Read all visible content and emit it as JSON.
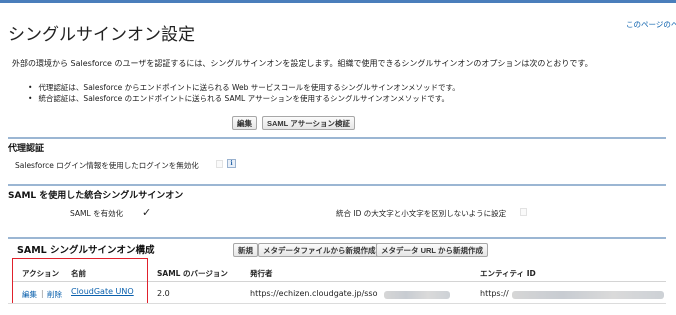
{
  "page": {
    "title": "シングルサインオン設定",
    "help_link": "このページのヘルプ"
  },
  "intro": {
    "text": "外部の環境から Salesforce のユーザを認証するには、シングルサインオンを設定します。組織で使用できるシングルサインオンのオプションは次のとおりです。",
    "bullets": [
      "代理認証は、Salesforce からエンドポイントに送られる Web サービスコールを使用するシングルサインオンメソッドです。",
      "統合認証は、Salesforce のエンドポイントに送られる SAML アサーションを使用するシングルサインオンメソッドです。"
    ]
  },
  "toolbar": {
    "edit_label": "編集",
    "saml_validate_label": "SAML アサーション検証"
  },
  "delegated": {
    "heading": "代理認証",
    "disable_login_label": "Salesforce ログイン情報を使用したログインを無効化",
    "info_icon": "i"
  },
  "saml_federated": {
    "heading": "SAML を使用した統合シングルサインオン",
    "enabled_label": "SAML を有効化",
    "enabled_mark": "✓",
    "case_insensitive_label": "統合 ID の大文字と小文字を区別しないように設定"
  },
  "saml_config": {
    "heading": "SAML シングルサインオン構成",
    "new_label": "新規",
    "new_from_metadata_file_label": "メタデータファイルから新規作成",
    "new_from_metadata_url_label": "メタデータ URL から新規作成",
    "columns": {
      "action": "アクション",
      "name": "名前",
      "saml_version": "SAML のバージョン",
      "issuer": "発行者",
      "entity_id": "エンティティ ID"
    },
    "rows": [
      {
        "edit": "編集",
        "separator": "|",
        "delete": "削除",
        "name": "CloudGate UNO",
        "saml_version": "2.0",
        "issuer": "https://echizen.cloudgate.jp/sso",
        "entity_id": "https://"
      }
    ]
  },
  "colors": {
    "link": "#0a60ad",
    "highlight": "#e0212c",
    "panel_border": "#9bb6d3"
  }
}
